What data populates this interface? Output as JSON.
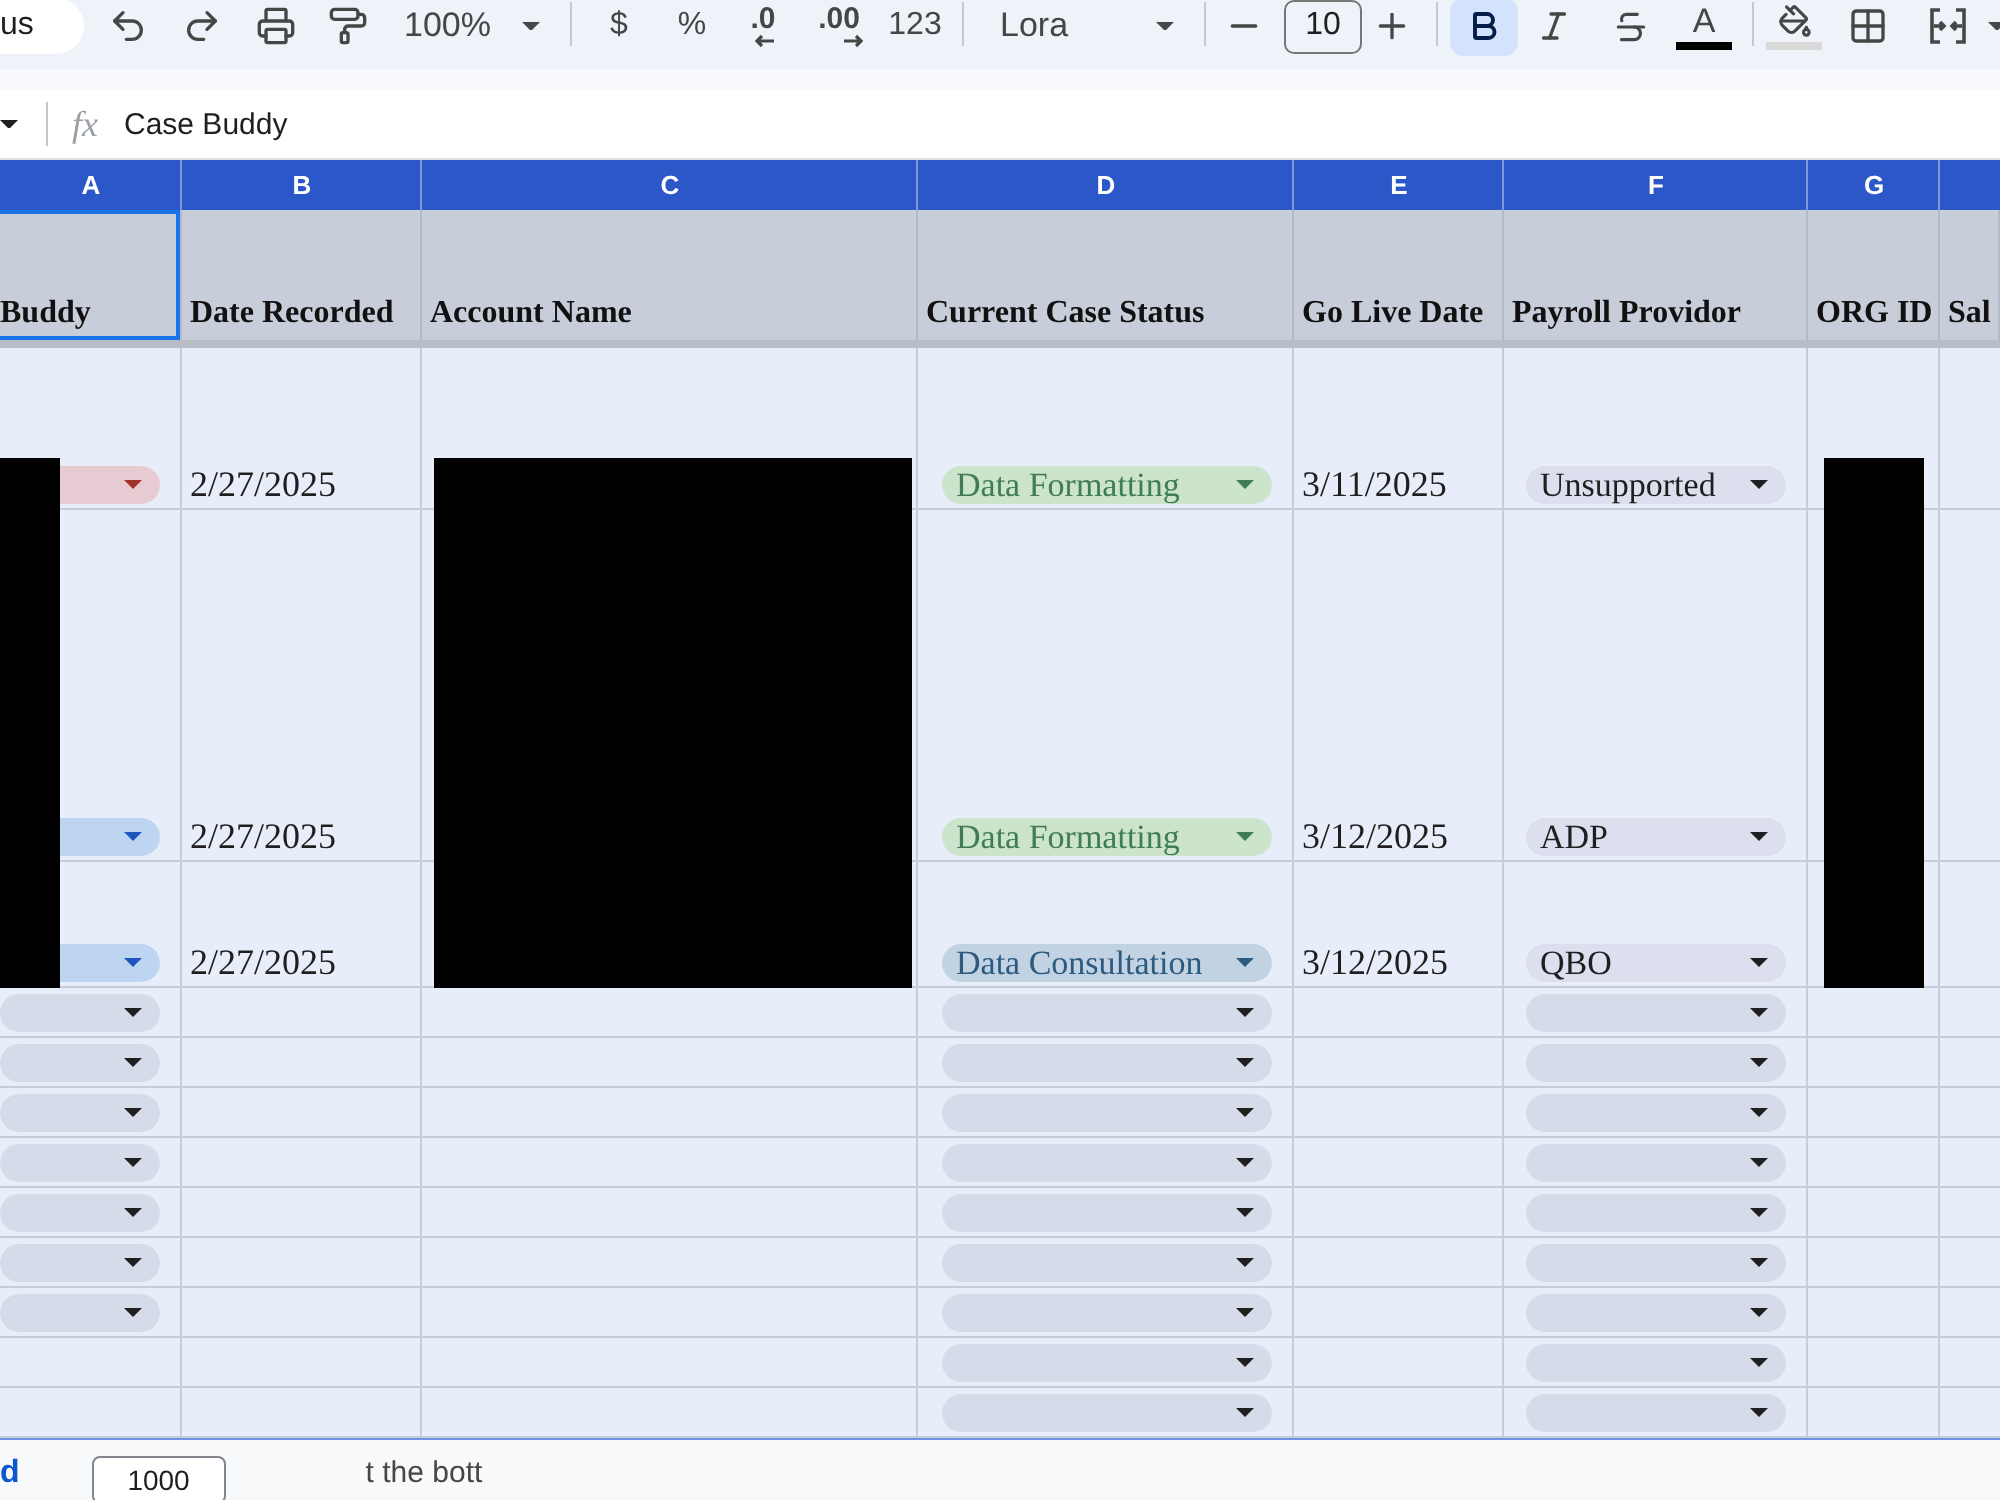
{
  "toolbar": {
    "search": "us",
    "items": [
      {
        "kind": "undo"
      },
      {
        "kind": "redo"
      },
      {
        "kind": "print"
      },
      {
        "kind": "paint_format"
      },
      {
        "kind": "zoom",
        "label": "100%"
      },
      {
        "kind": "divider"
      },
      {
        "kind": "currency",
        "label": "$"
      },
      {
        "kind": "percent",
        "label": "%"
      },
      {
        "kind": "decrease_decimal",
        "label": ".0"
      },
      {
        "kind": "increase_decimal",
        "label": ".00"
      },
      {
        "kind": "number_format",
        "label": "123"
      },
      {
        "kind": "divider"
      },
      {
        "kind": "font",
        "label": "Lora"
      },
      {
        "kind": "divider"
      },
      {
        "kind": "font_size_down"
      },
      {
        "kind": "font_size",
        "label": "10"
      },
      {
        "kind": "font_size_up"
      },
      {
        "kind": "divider"
      },
      {
        "kind": "bold",
        "on": true
      },
      {
        "kind": "italic",
        "on": false
      },
      {
        "kind": "strikethrough",
        "on": false
      },
      {
        "kind": "text_color",
        "label": "A",
        "color": "#000000"
      },
      {
        "kind": "divider"
      },
      {
        "kind": "fill_color",
        "color": "#d9d9d9"
      },
      {
        "kind": "borders"
      },
      {
        "kind": "merge"
      }
    ]
  },
  "formula_bar": {
    "fx": "fx",
    "value": "Case Buddy"
  },
  "columns": [
    {
      "letter": "A",
      "title": "Buddy",
      "selected": true
    },
    {
      "letter": "B",
      "title": "Date Recorded",
      "selected": false
    },
    {
      "letter": "C",
      "title": "Account Name",
      "selected": false
    },
    {
      "letter": "D",
      "title": "Current Case Status",
      "selected": false
    },
    {
      "letter": "E",
      "title": "Go Live Date",
      "selected": false
    },
    {
      "letter": "F",
      "title": "Payroll Providor",
      "selected": false
    },
    {
      "letter": "G",
      "title": "ORG ID",
      "selected": false
    },
    {
      "title": "Sal",
      "selected": false
    }
  ],
  "rows": [
    {
      "case_buddy": {
        "color": "#e6cbd2",
        "ink": {
          "color": "#a3312c"
        },
        "redacted": true
      },
      "date_recorded": "2/27/2025",
      "account_name": {
        "redacted": true
      },
      "status": {
        "label": "Data Formatting",
        "color": "#cce4cc",
        "ink": {
          "color": "#3f7c57"
        }
      },
      "go_live_date": "3/11/2025",
      "payroll_provider": {
        "label": "Unsupported",
        "color": "#dcdfee"
      },
      "org_id": {
        "redacted": true
      }
    },
    {
      "case_buddy": {
        "color": "#bed5f1",
        "ink": {
          "color": "#1e55c0"
        },
        "redacted": true
      },
      "date_recorded": "2/27/2025",
      "account_name": {
        "redacted": true
      },
      "status": {
        "label": "Data Formatting",
        "color": "#cce4cc",
        "ink": {
          "color": "#3f7c57"
        }
      },
      "go_live_date": "3/12/2025",
      "payroll_provider": {
        "label": "ADP",
        "color": "#dcdfee"
      },
      "org_id": {
        "redacted": true
      }
    },
    {
      "case_buddy": {
        "color": "#bed5f1",
        "ink": {
          "color": "#1e55c0"
        },
        "redacted": true
      },
      "date_recorded": "2/27/2025",
      "account_name": {
        "redacted": true
      },
      "status": {
        "label": "Data Consultation",
        "color": "#c1d3e3",
        "ink": {
          "color": "#2d5b7f"
        }
      },
      "go_live_date": "3/12/2025",
      "payroll_provider": {
        "label": "QBO",
        "color": "#dcdfee"
      },
      "org_id": {
        "redacted": true
      }
    },
    {
      "case_buddy": {
        "color": "#d5dbe9"
      },
      "status": {
        "color": "#d5dbe9"
      },
      "payroll_provider": {
        "color": "#d5dbe9"
      }
    },
    {
      "case_buddy": {
        "color": "#d5dbe9"
      },
      "status": {
        "color": "#d5dbe9"
      },
      "payroll_provider": {
        "color": "#d5dbe9"
      }
    },
    {
      "case_buddy": {
        "color": "#d5dbe9"
      },
      "status": {
        "color": "#d5dbe9"
      },
      "payroll_provider": {
        "color": "#d5dbe9"
      }
    },
    {
      "case_buddy": {
        "color": "#d5dbe9"
      },
      "status": {
        "color": "#d5dbe9"
      },
      "payroll_provider": {
        "color": "#d5dbe9"
      }
    },
    {
      "case_buddy": {
        "color": "#d5dbe9"
      },
      "status": {
        "color": "#d5dbe9"
      },
      "payroll_provider": {
        "color": "#d5dbe9"
      }
    },
    {
      "case_buddy": {
        "color": "#d5dbe9"
      },
      "status": {
        "color": "#d5dbe9"
      },
      "payroll_provider": {
        "color": "#d5dbe9"
      }
    },
    {
      "case_buddy": {
        "color": "#d5dbe9"
      },
      "status": {
        "color": "#d5dbe9"
      },
      "payroll_provider": {
        "color": "#d5dbe9"
      }
    },
    {
      "status": {
        "color": "#d5dbe9"
      },
      "payroll_provider": {
        "color": "#d5dbe9"
      }
    },
    {
      "status": {
        "color": "#d5dbe9"
      },
      "payroll_provider": {
        "color": "#d5dbe9"
      }
    }
  ],
  "bottom_bar": {
    "add_link": "d",
    "row_count": "1000",
    "note": "t the bott"
  }
}
